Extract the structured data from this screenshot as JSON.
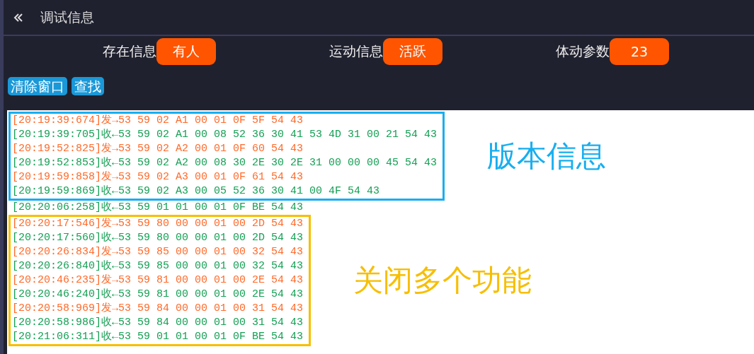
{
  "header": {
    "title": "调试信息"
  },
  "status": [
    {
      "label": "存在信息",
      "value": "有人"
    },
    {
      "label": "运动信息",
      "value": "活跃"
    },
    {
      "label": "体动参数",
      "value": "23"
    }
  ],
  "buttons": [
    "清除窗口",
    "查找"
  ],
  "log": [
    {
      "kind": "group",
      "color": "#18aef0",
      "annotation": "版本信息",
      "lines": [
        {
          "kind": "send",
          "text": "[20:19:39:674]发→53 59 02 A1 00 01 0F 5F 54 43"
        },
        {
          "kind": "receive",
          "text": "[20:19:39:705]收←53 59 02 A1 00 08 52 36 30 41 53 4D 31 00 21 54 43"
        },
        {
          "kind": "send",
          "text": "[20:19:52:825]发→53 59 02 A2 00 01 0F 60 54 43"
        },
        {
          "kind": "receive",
          "text": "[20:19:52:853]收←53 59 02 A2 00 08 30 2E 30 2E 31 00 00 00 45 54 43"
        },
        {
          "kind": "send",
          "text": "[20:19:59:858]发→53 59 02 A3 00 01 0F 61 54 43"
        },
        {
          "kind": "receive",
          "text": "[20:19:59:869]收←53 59 02 A3 00 05 52 36 30 41 00 4F 54 43"
        }
      ]
    },
    {
      "kind": "line",
      "line": {
        "kind": "receive",
        "text": "[20:20:06:258]收←53 59 01 01 00 01 0F BE 54 43"
      }
    },
    {
      "kind": "group",
      "color": "#f7be00",
      "annotation": "关闭多个功能",
      "lines": [
        {
          "kind": "send",
          "text": "[20:20:17:546]发→53 59 80 00 00 01 00 2D 54 43"
        },
        {
          "kind": "receive",
          "text": "[20:20:17:560]收←53 59 80 00 00 01 00 2D 54 43"
        },
        {
          "kind": "send",
          "text": "[20:20:26:834]发→53 59 85 00 00 01 00 32 54 43"
        },
        {
          "kind": "receive",
          "text": "[20:20:26:840]收←53 59 85 00 00 01 00 32 54 43"
        },
        {
          "kind": "send",
          "text": "[20:20:46:235]发→53 59 81 00 00 01 00 2E 54 43"
        },
        {
          "kind": "receive",
          "text": "[20:20:46:240]收←53 59 81 00 00 01 00 2E 54 43"
        },
        {
          "kind": "send",
          "text": "[20:20:58:969]发→53 59 84 00 00 01 00 31 54 43"
        },
        {
          "kind": "receive",
          "text": "[20:20:58:986]收←53 59 84 00 00 01 00 31 54 43"
        },
        {
          "kind": "receive",
          "text": "[20:21:06:311]收←53 59 01 01 00 01 0F BE 54 43"
        }
      ]
    }
  ]
}
